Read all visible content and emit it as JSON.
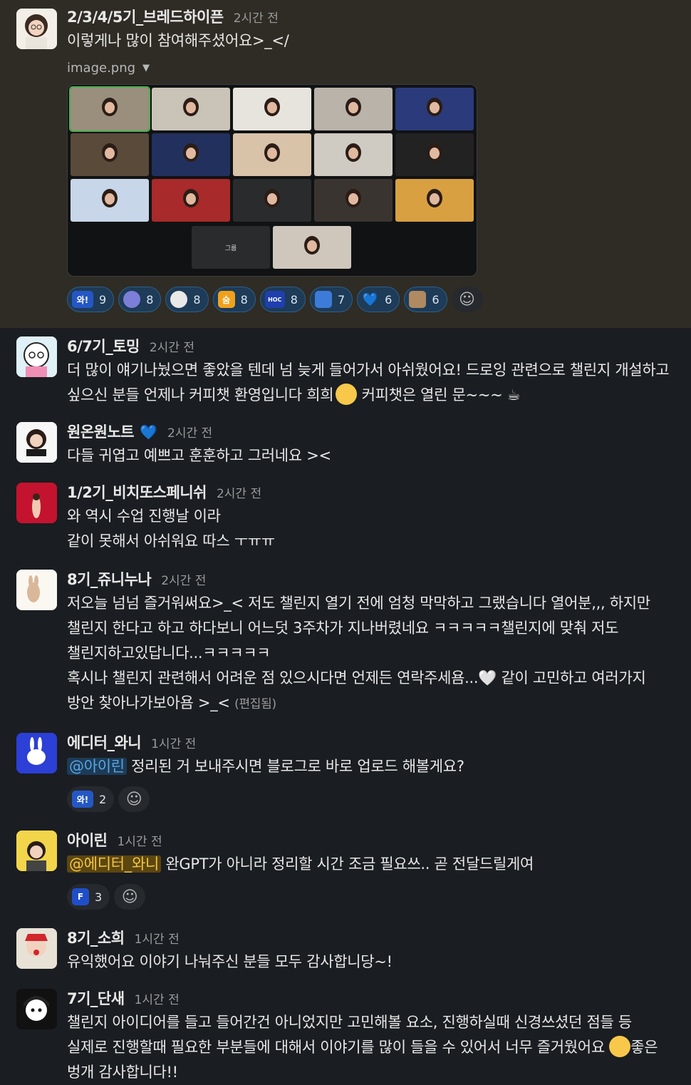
{
  "messages": [
    {
      "id": "m1",
      "name": "2/3/4/5기_브레드하이픈",
      "time": "2시간 전",
      "lines": [
        "이렇게나 많이 참여해주셨어요>_</"
      ],
      "file_name": "image.png",
      "tile_label": "그룹",
      "reactions": [
        {
          "icon": "wow-emoji",
          "label": "와!",
          "count": "9"
        },
        {
          "icon": "blob-emoji",
          "label": "",
          "count": "8"
        },
        {
          "icon": "face-emoji",
          "label": "",
          "count": "8"
        },
        {
          "icon": "sugo-emoji",
          "label": "숨",
          "count": "8"
        },
        {
          "icon": "hoc-emoji",
          "label": "HOC",
          "count": "8"
        },
        {
          "icon": "shoe-emoji",
          "label": "",
          "count": "7"
        },
        {
          "icon": "blue-heart-emoji",
          "label": "💙",
          "count": "6"
        },
        {
          "icon": "puppy-emoji",
          "label": "",
          "count": "6"
        }
      ]
    },
    {
      "id": "m2",
      "name": "6/7기_토밍",
      "time": "2시간 전",
      "text_a": "더 많이 얘기나눴으면 좋았을 텐데 넘 늦게 들어가서 아쉬웠어요! 드로잉 관련으로 챌린지 개설하고 싶으신 분들 언제나 커피챗 환영입니다 희희",
      "text_b": " 커피챗은 열린 문~~~ ",
      "coffee": "☕"
    },
    {
      "id": "m3",
      "name": "원온원노트",
      "time": "2시간 전",
      "badge": "💙",
      "lines": [
        "다들 귀엽고 예쁘고 훈훈하고 그러네요 ><"
      ]
    },
    {
      "id": "m4",
      "name": "1/2기_비치또스페니쉬",
      "time": "2시간 전",
      "lines": [
        "와 역시 수업 진행날 이라",
        "같이 못해서 아쉬워요 따스 ㅜㅠㅠ"
      ]
    },
    {
      "id": "m5",
      "name": "8기_쥬니누나",
      "time": "2시간 전",
      "text_a": "저오늘 넘넘 즐거워써요>_< 저도 챌린지 열기 전에 엄청 막막하고 그랬습니다 열어분,,, 하지만 챌린지 한다고 하고 하다보니 어느덧 3주차가 지나버렸네요 ㅋㅋㅋㅋㅋ챌린지에 맞춰 저도 챌린지하고있답니다...ㅋㅋㅋㅋㅋ",
      "text_b": "혹시나 챌린지 관련해서 어려운 점 있으시다면 언제든 연락주세욤...",
      "heart": "🤍",
      "text_c": " 같이 고민하고 여러가지 방안 찾아나가보아욤 >_< ",
      "edited": "(편집됨)"
    },
    {
      "id": "m6",
      "name": "에디터_와니",
      "time": "1시간 전",
      "mention": "@아이린",
      "text": " 정리된 거 보내주시면 블로그로 바로 업로드 해볼게요?",
      "reactions": [
        {
          "icon": "wow-emoji",
          "label": "와!",
          "count": "2"
        }
      ]
    },
    {
      "id": "m7",
      "name": "아이린",
      "time": "1시간 전",
      "mention": "@에디터_와니",
      "text": " 완GPT가 아니라 정리할 시간 조금 필요쓰.. 곧 전달드릴게여",
      "reactions": [
        {
          "icon": "f-emoji",
          "label": "F",
          "count": "3"
        }
      ]
    },
    {
      "id": "m8",
      "name": "8기_소희",
      "time": "1시간 전",
      "lines": [
        "유익했어요 이야기 나눠주신 분들 모두 감사합니당~!"
      ]
    },
    {
      "id": "m9",
      "name": "7기_단새",
      "time": "1시간 전",
      "text_a": "챌린지 아이디어를 들고 들어간건 아니었지만 고민해볼 요소, 진행하실때 신경쓰셨던 점들 등 실제로 진행할때 필요한 부분들에 대해서 이야기를 많이 들을 수 있어서 너무 즐거웠어요 ",
      "text_b": "좋은 벙개 감사합니다!!"
    }
  ],
  "colors": {
    "background": "#1a1d21",
    "highlight": "#2f2c25",
    "reaction_bg": "#1e3b57",
    "mention": "#58a6e4",
    "self_mention": "#f2c744"
  }
}
